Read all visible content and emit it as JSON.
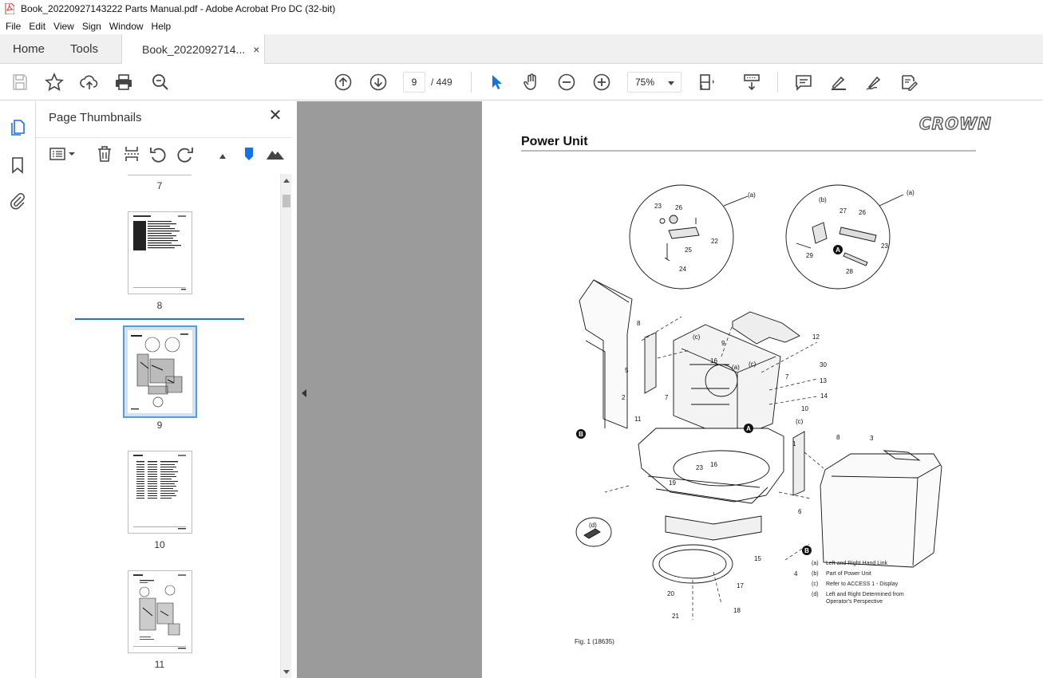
{
  "window": {
    "title": "Book_20220927143222 Parts Manual.pdf - Adobe Acrobat Pro DC (32-bit)"
  },
  "menu": [
    "File",
    "Edit",
    "View",
    "Sign",
    "Window",
    "Help"
  ],
  "tabs": {
    "home": "Home",
    "tools": "Tools",
    "document": "Book_2022092714...",
    "close": "×"
  },
  "toolbar": {
    "current_page": "9",
    "total_pages": "/ 449",
    "zoom": "75%"
  },
  "panel": {
    "title": "Page Thumbnails",
    "thumbnails": [
      {
        "label": "7"
      },
      {
        "label": "8"
      },
      {
        "label": "9",
        "selected": true
      },
      {
        "label": "10"
      },
      {
        "label": "11"
      }
    ]
  },
  "document_page": {
    "brand": "CROWN",
    "heading": "Power Unit",
    "figure_caption": "Fig. 1 (18635)",
    "callouts": [
      "(a)",
      "23",
      "26",
      "22",
      "25",
      "24",
      "(b)",
      "27",
      "26",
      "(a)",
      "29",
      "23",
      "28",
      "8",
      "(c)",
      "9",
      "12",
      "16",
      "(a)",
      "(c)",
      "7",
      "30",
      "13",
      "14",
      "5",
      "7",
      "2",
      "11",
      "10",
      "(c)",
      "1",
      "8",
      "3",
      "16",
      "23",
      "19",
      "6",
      "(d)",
      "15",
      "17",
      "20",
      "18",
      "21",
      "4"
    ],
    "markers": [
      "A",
      "A",
      "B",
      "B"
    ],
    "legend": [
      {
        "key": "(a)",
        "text": "Left and Right Hand Link"
      },
      {
        "key": "(b)",
        "text": "Part of Power Unit"
      },
      {
        "key": "(c)",
        "text": "Refer to ACCESS 1 - Display"
      },
      {
        "key": "(d)",
        "text": "Left and Right Determined from Operator's Perspective"
      }
    ]
  },
  "colors": {
    "accent": "#1473e6",
    "pdf_red": "#d9302a",
    "viewer_gray": "#9b9b9b",
    "chrome": "#f0f0f0"
  }
}
